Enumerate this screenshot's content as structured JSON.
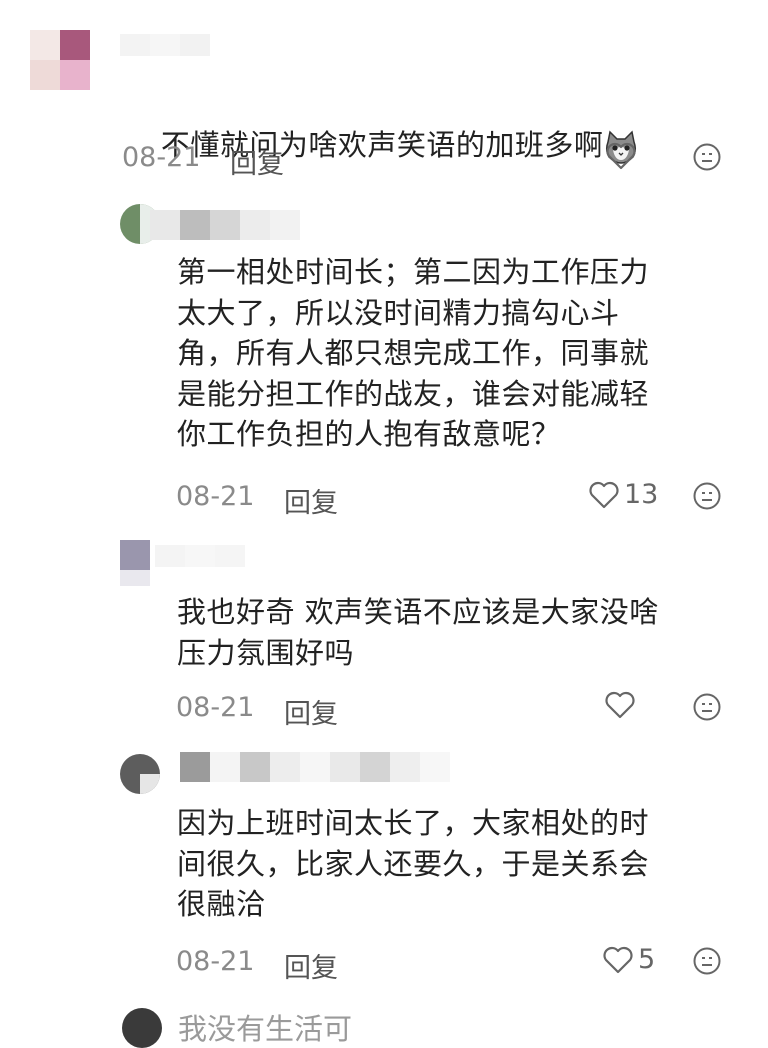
{
  "comments": [
    {
      "text": "不懂就问为啥欢声笑语的加班多啊",
      "date": "08-21",
      "reply": "回复",
      "likes": ""
    },
    {
      "text": "第一相处时间长；第二因为工作压力\n太大了，所以没时间精力搞勾心斗\n角，所有人都只想完成工作，同事就\n是能分担工作的战友，谁会对能减轻\n你工作负担的人抱有敌意呢？",
      "date": "08-21",
      "reply": "回复",
      "likes": "13"
    },
    {
      "text": "我也好奇 欢声笑语不应该是大家没啥\n压力氛围好吗",
      "date": "08-21",
      "reply": "回复",
      "likes": ""
    },
    {
      "text": "因为上班时间太长了，大家相处的时\n间很久，比家人还要久，于是关系会\n很融洽",
      "date": "08-21",
      "reply": "回复",
      "likes": "5"
    }
  ],
  "partial": {
    "username": "我没有生活可"
  },
  "icons": {
    "like": "heart-outline-icon",
    "react": "emoji-face-icon",
    "emoji": "cat-emoji"
  }
}
